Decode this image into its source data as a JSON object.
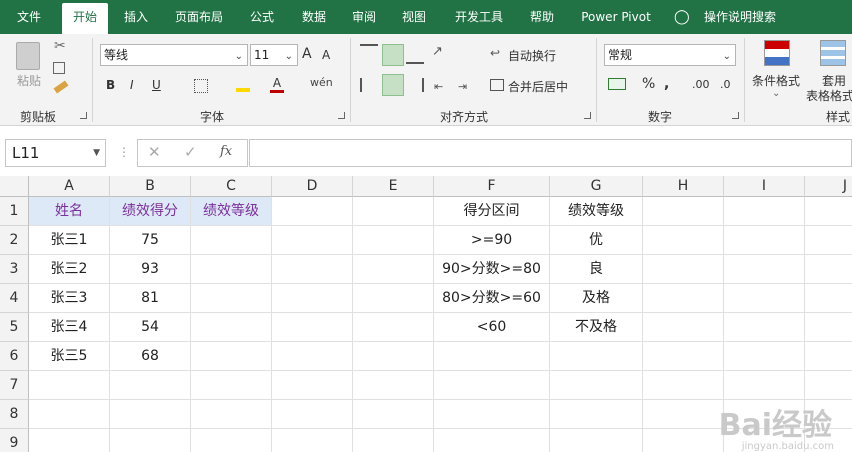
{
  "tabs": [
    "文件",
    "开始",
    "插入",
    "页面布局",
    "公式",
    "数据",
    "审阅",
    "视图",
    "开发工具",
    "帮助",
    "Power Pivot",
    "操作说明搜索"
  ],
  "ribbon": {
    "clipboard": {
      "paste": "粘贴",
      "label": "剪贴板"
    },
    "font": {
      "name": "等线",
      "size": "11",
      "grow": "A",
      "shrink": "A",
      "bold": "B",
      "italic": "I",
      "underline": "U",
      "font_color": "A",
      "phonetic": "wén",
      "label": "字体"
    },
    "alignment": {
      "wrap": "自动换行",
      "merge": "合并后居中",
      "label": "对齐方式"
    },
    "number": {
      "format": "常规",
      "percent": "%",
      "comma": ",",
      "inc_decimal": ".00",
      "dec_decimal": ".0",
      "label": "数字"
    },
    "styles": {
      "cond_format": "条件格式",
      "table_format_1": "套用",
      "table_format_2": "表格格式",
      "label": "样式"
    }
  },
  "formula_bar": {
    "name_box": "L11",
    "fx": "fx",
    "value": ""
  },
  "columns": [
    "A",
    "B",
    "C",
    "D",
    "E",
    "F",
    "G",
    "H",
    "I",
    "J"
  ],
  "rows": [
    "1",
    "2",
    "3",
    "4",
    "5",
    "6",
    "7",
    "8",
    "9"
  ],
  "table1": {
    "headers": [
      "姓名",
      "绩效得分",
      "绩效等级"
    ],
    "rows": [
      [
        "张三1",
        "75",
        ""
      ],
      [
        "张三2",
        "93",
        ""
      ],
      [
        "张三3",
        "81",
        ""
      ],
      [
        "张三4",
        "54",
        ""
      ],
      [
        "张三5",
        "68",
        ""
      ]
    ]
  },
  "table2": {
    "headers": [
      "得分区间",
      "绩效等级"
    ],
    "rows": [
      [
        ">=90",
        "优"
      ],
      [
        "90>分数>=80",
        "良"
      ],
      [
        "80>分数>=60",
        "及格"
      ],
      [
        "<60",
        "不及格"
      ]
    ]
  },
  "watermark": {
    "brand": "Bai经验",
    "url": "jingyan.baidu.com"
  },
  "colors": {
    "ribbon_green": "#217346",
    "header_fill": "#dde9f6",
    "header_text": "#7b2f9c"
  }
}
